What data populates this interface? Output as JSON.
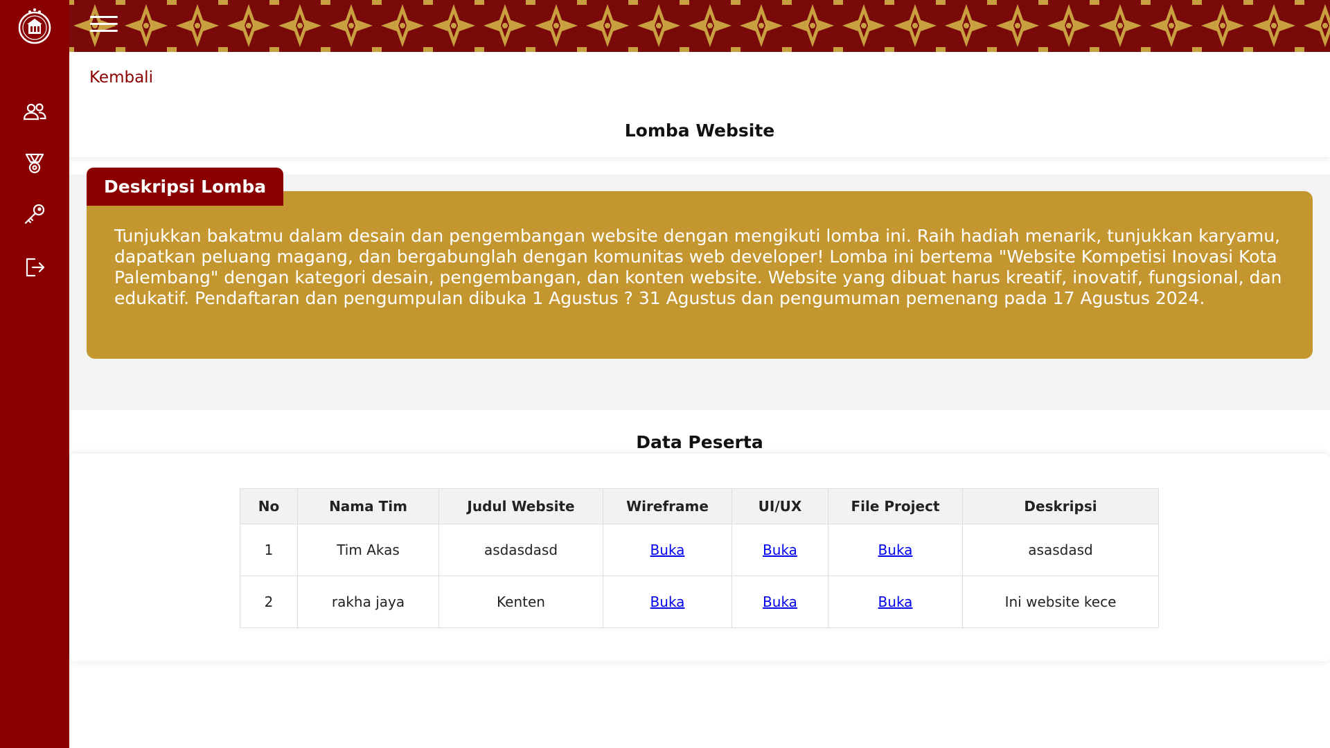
{
  "header": {
    "menu_icon": "hamburger-icon",
    "banner_colors": {
      "background": "#7a0a0a",
      "motif": "#c8a040"
    }
  },
  "sidebar": {
    "logo": "university-emblem",
    "items": [
      {
        "icon": "users-icon"
      },
      {
        "icon": "medal-icon"
      },
      {
        "icon": "key-icon"
      },
      {
        "icon": "logout-icon"
      }
    ]
  },
  "main": {
    "back_label": "Kembali",
    "page_title": "Lomba Website",
    "description": {
      "tab_label": "Deskripsi Lomba",
      "text": "Tunjukkan bakatmu dalam desain dan pengembangan website dengan mengikuti lomba ini. Raih hadiah menarik, tunjukkan karyamu, dapatkan peluang magang, dan bergabunglah dengan komunitas web developer! Lomba ini bertema \"Website Kompetisi Inovasi Kota Palembang\" dengan kategori desain, pengembangan, dan konten website. Website yang dibuat harus kreatif, inovatif, fungsional, dan edukatif. Pendaftaran dan pengumpulan dibuka 1 Agustus ? 31 Agustus dan pengumuman pemenang pada 17 Agustus 2024."
    },
    "participants": {
      "title": "Data Peserta",
      "columns": [
        "No",
        "Nama Tim",
        "Judul Website",
        "Wireframe",
        "UI/UX",
        "File Project",
        "Deskripsi"
      ],
      "rows": [
        {
          "no": "1",
          "team": "Tim Akas",
          "website_title": "asdasdasd",
          "wireframe": "Buka",
          "uiux": "Buka",
          "file_project": "Buka",
          "description": "asasdasd"
        },
        {
          "no": "2",
          "team": "rakha jaya",
          "website_title": "Kenten",
          "wireframe": "Buka",
          "uiux": "Buka",
          "file_project": "Buka",
          "description": "Ini website kece"
        }
      ]
    }
  },
  "colors": {
    "brand_red": "#8a0000",
    "gold": "#c4962f",
    "link": "#0000ee"
  }
}
